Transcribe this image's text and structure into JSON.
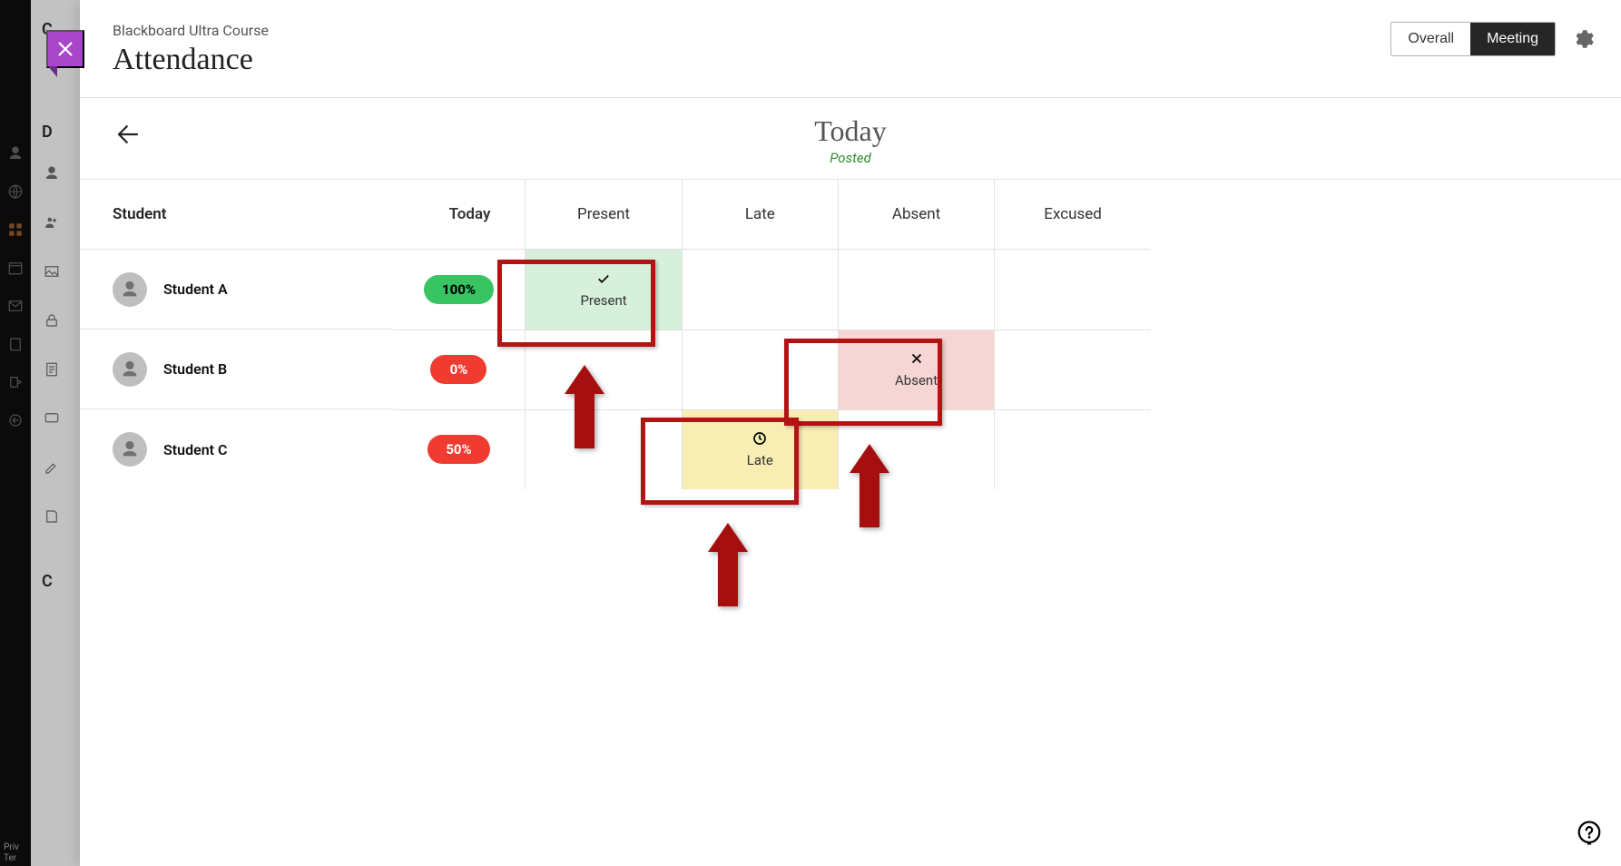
{
  "course_name": "Blackboard Ultra Course",
  "page_title": "Attendance",
  "view_toggle": {
    "overall": "Overall",
    "meeting": "Meeting",
    "active": "meeting"
  },
  "date_header": {
    "label": "Today",
    "status": "Posted"
  },
  "columns": {
    "student": "Student",
    "today": "Today",
    "present": "Present",
    "late": "Late",
    "absent": "Absent",
    "excused": "Excused"
  },
  "status_labels": {
    "present": "Present",
    "late": "Late",
    "absent": "Absent"
  },
  "students": [
    {
      "name": "Student  A",
      "today_pct": "100%",
      "today_color": "green",
      "status": "present"
    },
    {
      "name": "Student  B",
      "today_pct": "0%",
      "today_color": "red",
      "status": "absent"
    },
    {
      "name": "Student  C",
      "today_pct": "50%",
      "today_color": "red",
      "status": "late"
    }
  ],
  "left_letters": [
    "C",
    "D",
    "C"
  ],
  "bottom_corner": "Priv\nTer"
}
